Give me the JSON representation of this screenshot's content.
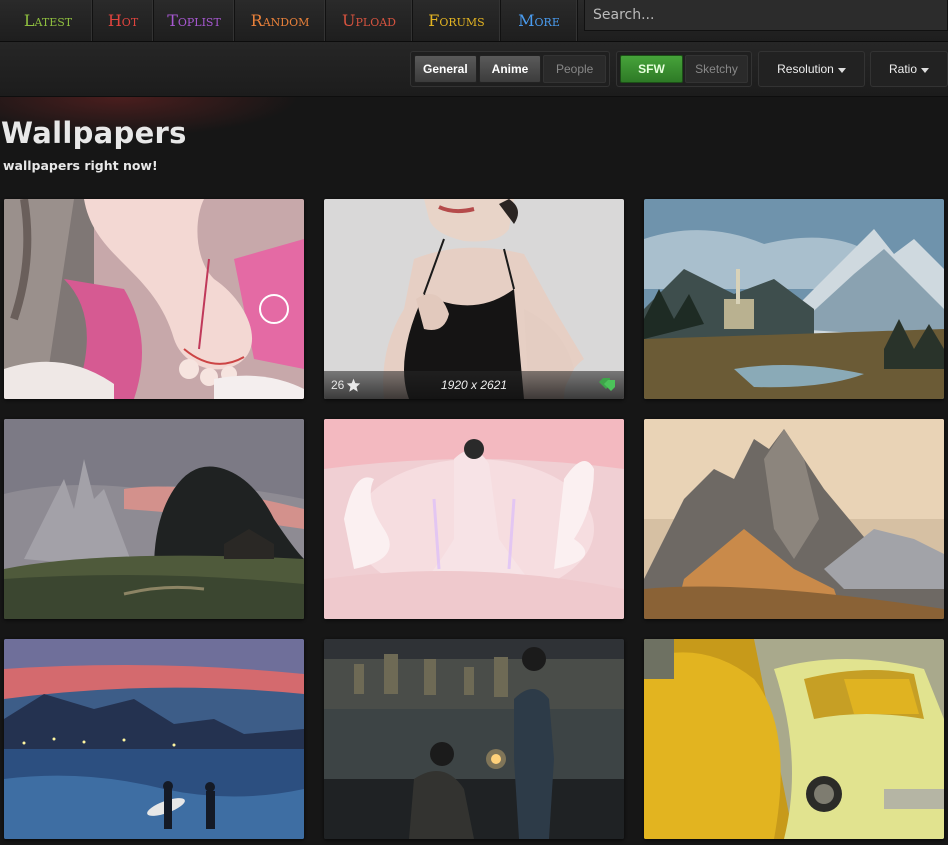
{
  "nav": {
    "latest": "Latest",
    "hot": "Hot",
    "toplist": "Toplist",
    "random": "Random",
    "upload": "Upload",
    "forums": "Forums",
    "more": "More"
  },
  "search": {
    "placeholder": "Search..."
  },
  "filters": {
    "categories": {
      "general": "General",
      "anime": "Anime",
      "people": "People"
    },
    "purity": {
      "sfw": "SFW",
      "sketchy": "Sketchy"
    },
    "resolution": "Resolution",
    "ratio": "Ratio"
  },
  "header": {
    "title": "Wallpapers",
    "subtitle": "wallpapers right now!"
  },
  "thumbs": [
    {
      "id": 1,
      "subject": "anime-feet-illustration"
    },
    {
      "id": 2,
      "subject": "woman-black-dress",
      "favorites": "26",
      "resolution": "1920 x 2621",
      "hover": true
    },
    {
      "id": 3,
      "subject": "mountain-castle-lake"
    },
    {
      "id": 4,
      "subject": "misty-castle-hills"
    },
    {
      "id": 5,
      "subject": "pink-swan-dancer"
    },
    {
      "id": 6,
      "subject": "rocky-peaks-sunset"
    },
    {
      "id": 7,
      "subject": "beach-surfers-dusk"
    },
    {
      "id": 8,
      "subject": "city-lights-sparkler"
    },
    {
      "id": 9,
      "subject": "yellow-car-flowers"
    }
  ],
  "colors": {
    "latest": "#8fbf3f",
    "hot": "#e0443e",
    "toplist": "#a758d1",
    "random": "#e8803a",
    "upload": "#d6533f",
    "forums": "#e2b322",
    "more": "#4a9cf0",
    "sfw": "#3a9a30"
  }
}
